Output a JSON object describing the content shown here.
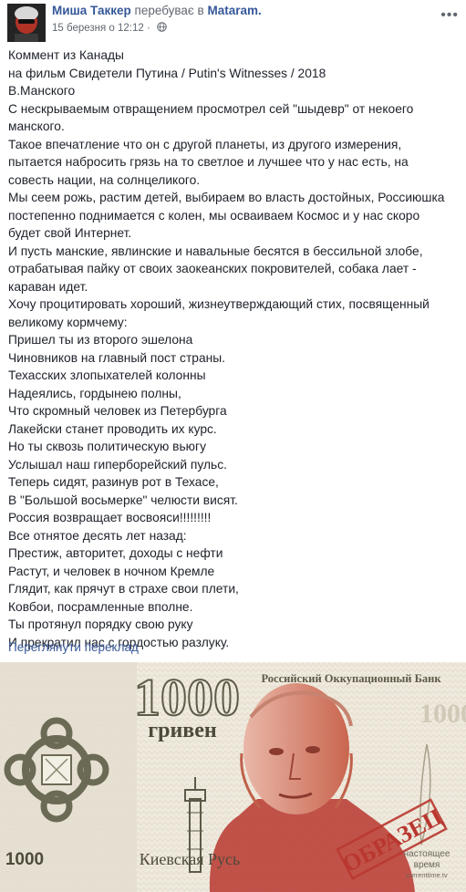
{
  "post": {
    "author": "Миша Таккер",
    "action": "перебуває в",
    "place": "Mataram.",
    "timestamp": "15 березня о 12:12 ·",
    "privacy_icon": "globe-icon",
    "more_icon": "ellipsis-icon",
    "lines": [
      "Коммент из Канады",
      "на фильм Свидетели Путина / Putin's Witnesses / 2018",
      "В.Манского",
      "С нескрываемым отвращением просмотрел сей \"шыдевр\" от некоего",
      "манского.",
      "Такое впечатление что он с другой планеты, из другого измерения,",
      "пытается набросить грязь на то светлое и лучшее что у нас есть, на",
      "совесть нации, на солнцеликого.",
      "Мы сеем рожь, растим детей, выбираем во власть достойных, Россиюшка",
      "постепенно поднимается с колен, мы осваиваем Космос и у нас скоро",
      "будет свой Интернет.",
      "И пусть манские, явлинские и навальные бесятся в бессильной злобе,",
      "отрабатывая пайку от своих заокеанских покровителей, собака лает -",
      "караван идет.",
      "Хочу процитировать хороший, жизнеутверждающий стих, посвященный",
      "великому кормчему:",
      "Пришел ты из второго эшелона",
      "Чиновников на главный пост страны.",
      "Техасских злопыхателей колонны",
      "Надеялись, гордынею полны,",
      "Что скромный человек из Петербурга",
      "Лакейски станет проводить их курс.",
      "Но ты сквозь политическую вьюгу",
      "Услышал наш гиперборейский пульс.",
      "Теперь сидят, разинув рот в Техасе,",
      "В \"Большой восьмерке\" челюсти висят.",
      "Россия возвращает восвояси!!!!!!!!!",
      "Все отнятое десять лет назад:",
      "Престиж, авторитет, доходы с нефти",
      "Растут, и человек в ночном Кремле",
      "Глядит, как прячут в страхе свои плети,",
      "Ковбои, посрамленные вполне.",
      "Ты протянул порядку свою руку",
      "И прекратил нас с гордостью разлуку."
    ],
    "see_translation": "Переглянути переклад"
  },
  "banknote": {
    "bank_name": "Российский Оккупационный Банк",
    "denomination": "1000",
    "currency": "гривен",
    "region": "Киевская Русь",
    "stamp": "ОБРАЗЕЦ",
    "watermark_line1": "настоящее",
    "watermark_line2": "время",
    "watermark_url": "currenttime.tv"
  },
  "colors": {
    "link": "#365899",
    "meta": "#616770",
    "text": "#1d2129",
    "note_red": "#b9372f",
    "note_paper": "#efeade"
  }
}
